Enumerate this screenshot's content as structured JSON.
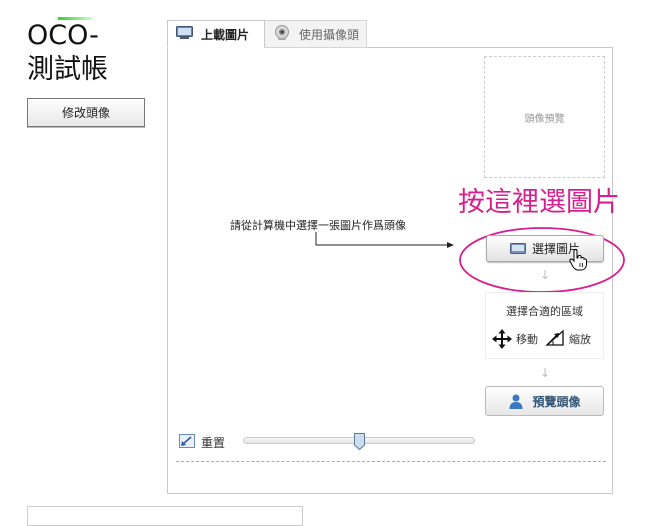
{
  "header": {
    "title_line1": "OCO-",
    "title_line2": "測試帳"
  },
  "edit_avatar_button": "修改頭像",
  "tabs": [
    {
      "label": "上載圖片",
      "icon": "monitor-icon",
      "active": true
    },
    {
      "label": "使用攝像頭",
      "icon": "webcam-icon",
      "active": false
    }
  ],
  "preview_box_label": "頭像預覽",
  "annotation": {
    "text": "按這裡選圖片",
    "color": "#d61f8e"
  },
  "instruction_text": "請從計算機中選擇一張圖片作爲頭像",
  "choose_image_button": "選擇圖片",
  "crop_area": {
    "title": "選擇合適的區域",
    "move_label": "移動",
    "zoom_label": "縮放"
  },
  "preview_avatar_button": "預覽頭像",
  "reset_label": "重置",
  "zoom_slider": {
    "value": 0.5
  }
}
